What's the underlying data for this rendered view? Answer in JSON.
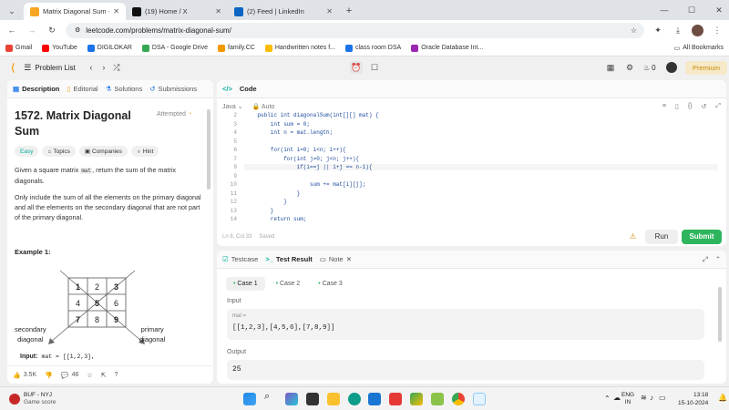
{
  "browser": {
    "tabs": [
      {
        "title": "Matrix Diagonal Sum - LeetCod",
        "color": "#f5a623"
      },
      {
        "title": "(19) Home / X",
        "color": "#111"
      },
      {
        "title": "(2) Feed | LinkedIn",
        "color": "#0a66c2"
      }
    ],
    "url": "leetcode.com/problems/matrix-diagonal-sum/",
    "bookmarks": [
      {
        "label": "Gmail",
        "color": "#ea4335"
      },
      {
        "label": "YouTube",
        "color": "#ff0000"
      },
      {
        "label": "DIGILOKAR",
        "color": "#1a73e8"
      },
      {
        "label": "DSA - Google Drive",
        "color": "#34a853"
      },
      {
        "label": "family.CC",
        "color": "#f29900"
      },
      {
        "label": "Handwritten notes f...",
        "color": "#fbbc04"
      },
      {
        "label": "class room DSA",
        "color": "#1a73e8"
      },
      {
        "label": "Oracle Database Int...",
        "color": "#9c27b0"
      }
    ],
    "all_bookmarks": "All Bookmarks"
  },
  "lc": {
    "problem_list": "Problem List",
    "streak": "0",
    "premium": "Premium"
  },
  "desc": {
    "tabs": [
      "Description",
      "Editorial",
      "Solutions",
      "Submissions"
    ],
    "title": "1572. Matrix Diagonal Sum",
    "status": "Attempted",
    "chips": [
      "Easy",
      "Topics",
      "Companies",
      "Hint"
    ],
    "para1_a": "Given a square matrix ",
    "para1_code": "mat",
    "para1_b": ", return the sum of the matrix diagonals.",
    "para2": "Only include the sum of all the elements on the primary diagonal and all the elements on the secondary diagonal that are not part of the primary diagonal.",
    "example": "Example 1:",
    "grid": [
      "1",
      "2",
      "3",
      "4",
      "5",
      "6",
      "7",
      "8",
      "9"
    ],
    "secondary": "secondary\ndiagonal",
    "primary": "primary\ndiagonal",
    "input_label": "Input:",
    "input_val": "mat = [[1,2,3],",
    "likes": "3.5K",
    "comments": "46"
  },
  "code": {
    "title": "Code",
    "lang": "Java",
    "auto": "Auto",
    "lines": [
      {
        "n": "2",
        "t": "    public int diagonalSum(int[][] mat) {"
      },
      {
        "n": "3",
        "t": "        int sum = 0;"
      },
      {
        "n": "4",
        "t": "        int n = mat.length;"
      },
      {
        "n": "5",
        "t": ""
      },
      {
        "n": "6",
        "t": "        for(int i=0; i<n; i++){"
      },
      {
        "n": "7",
        "t": "            for(int j=0; j<n; j++){"
      },
      {
        "n": "8",
        "t": "                if(i==j || i+j == n-1){"
      },
      {
        "n": "9",
        "t": ""
      },
      {
        "n": "10",
        "t": "                    sum += mat[i][j];"
      },
      {
        "n": "11",
        "t": "                }"
      },
      {
        "n": "12",
        "t": "            }"
      },
      {
        "n": "13",
        "t": "        }"
      },
      {
        "n": "14",
        "t": "        return sum;"
      }
    ],
    "status": "Ln 8, Col 33",
    "saved": "Saved",
    "run": "Run",
    "submit": "Submit"
  },
  "result": {
    "tabs": [
      "Testcase",
      "Test Result",
      "Note"
    ],
    "cases": [
      "Case 1",
      "Case 2",
      "Case 3"
    ],
    "input_label": "Input",
    "var": "mat =",
    "value": "[[1,2,3],[4,5,6],[7,8,9]]",
    "output_label": "Output",
    "output": "25"
  },
  "taskbar": {
    "weather_title": "BUF - NYJ",
    "weather_sub": "Game score",
    "lang1": "ENG",
    "lang2": "IN",
    "time": "13:18",
    "date": "15-10-2024"
  }
}
